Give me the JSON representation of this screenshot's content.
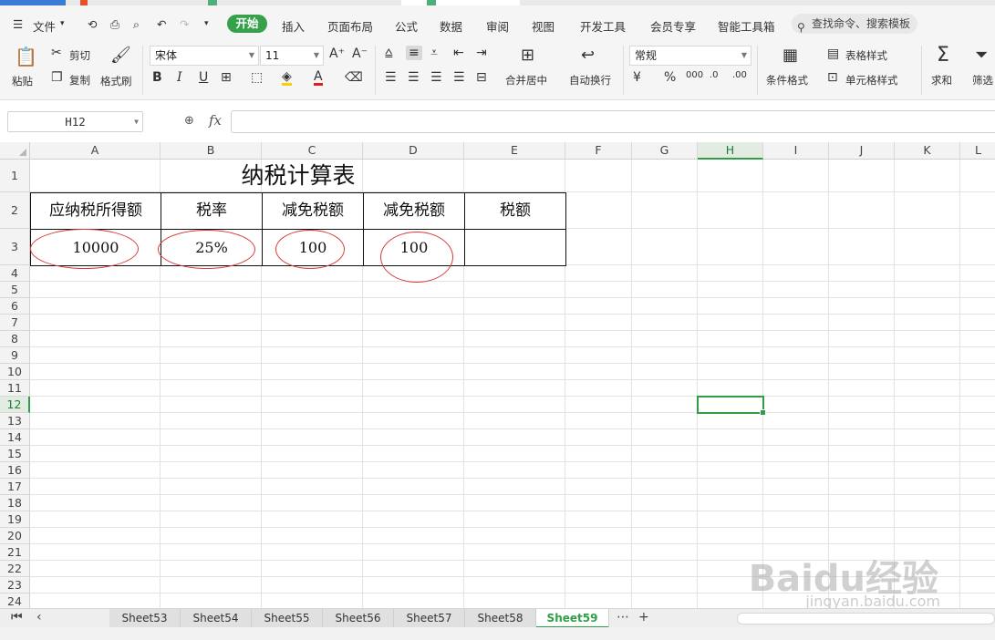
{
  "menu": {
    "file": "文件",
    "tabs": [
      "开始",
      "插入",
      "页面布局",
      "公式",
      "数据",
      "审阅",
      "视图",
      "开发工具",
      "会员专享",
      "智能工具箱"
    ],
    "active_tab": "开始",
    "search_placeholder": "查找命令、搜索模板"
  },
  "ribbon": {
    "paste": "粘贴",
    "cut": "剪切",
    "copy": "复制",
    "format_painter": "格式刷",
    "font_name": "宋体",
    "font_size": "11",
    "merge_center": "合并居中",
    "wrap_text": "自动换行",
    "number_format": "常规",
    "conditional_format": "条件格式",
    "table_style": "表格样式",
    "cell_style": "单元格样式",
    "sum": "求和",
    "filter": "筛选"
  },
  "formula_bar": {
    "name_box": "H12",
    "fx": "fx",
    "content": ""
  },
  "columns": [
    "A",
    "B",
    "C",
    "D",
    "E",
    "F",
    "G",
    "H",
    "I",
    "J",
    "K",
    "L"
  ],
  "selected_column": "H",
  "selected_row": "12",
  "rows": [
    "1",
    "2",
    "3",
    "4",
    "5",
    "6",
    "7",
    "8",
    "9",
    "10",
    "11",
    "12",
    "13",
    "14",
    "15",
    "16",
    "17",
    "18",
    "19",
    "20",
    "21",
    "22",
    "23",
    "24"
  ],
  "sheet": {
    "title": "纳税计算表",
    "headers": [
      "应纳税所得额",
      "税率",
      "减免税额",
      "减免税额",
      "税额"
    ],
    "values": [
      "10000",
      "25%",
      "100",
      "100",
      ""
    ]
  },
  "sheet_tabs": [
    "Sheet53",
    "Sheet54",
    "Sheet55",
    "Sheet56",
    "Sheet57",
    "Sheet58",
    "Sheet59"
  ],
  "active_sheet": "Sheet59",
  "watermark": {
    "logo": "Baidu经验",
    "url": "jingyan.baidu.com"
  },
  "colors": {
    "accent": "#2f9e44",
    "annotation": "#d93a3a"
  }
}
